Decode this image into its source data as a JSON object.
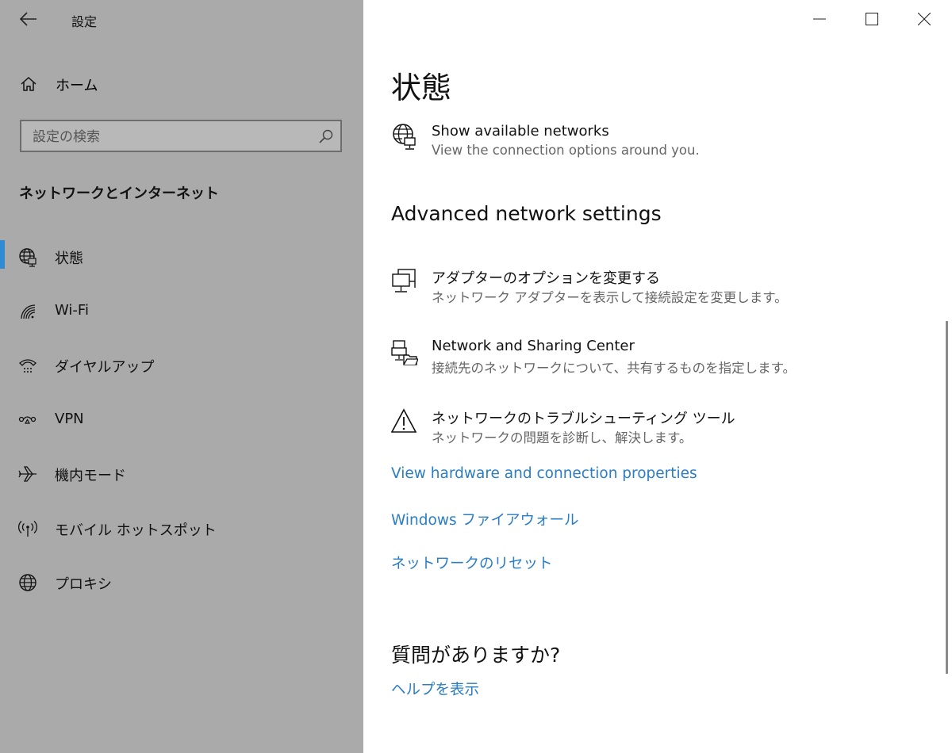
{
  "window": {
    "title": "設定"
  },
  "sidebar": {
    "home_label": "ホーム",
    "search": {
      "placeholder": "設定の検索"
    },
    "section_title": "ネットワークとインターネット",
    "items": [
      {
        "label": "状態",
        "icon": "status-globe-icon",
        "active": true
      },
      {
        "label": "Wi-Fi",
        "icon": "wifi-icon",
        "active": false
      },
      {
        "label": "ダイヤルアップ",
        "icon": "dialup-icon",
        "active": false
      },
      {
        "label": "VPN",
        "icon": "vpn-icon",
        "active": false
      },
      {
        "label": "機内モード",
        "icon": "airplane-icon",
        "active": false
      },
      {
        "label": "モバイル ホットスポット",
        "icon": "hotspot-icon",
        "active": false
      },
      {
        "label": "プロキシ",
        "icon": "globe-icon",
        "active": false
      }
    ]
  },
  "main": {
    "title": "状態",
    "available_networks": {
      "title": "Show available networks",
      "subtitle": "View the connection options around you."
    },
    "advanced_heading": "Advanced network settings",
    "advanced_items": [
      {
        "title": "アダプターのオプションを変更する",
        "subtitle": "ネットワーク アダプターを表示して接続設定を変更します。",
        "icon": "adapter-icon"
      },
      {
        "title": "Network and Sharing Center",
        "subtitle": "接続先のネットワークについて、共有するものを指定します。",
        "icon": "sharing-center-icon"
      },
      {
        "title": "ネットワークのトラブルシューティング ツール",
        "subtitle": "ネットワークの問題を診断し、解決します。",
        "icon": "warning-icon"
      }
    ],
    "links": [
      "View hardware and connection properties",
      "Windows ファイアウォール",
      "ネットワークのリセット"
    ],
    "help_heading": "質問がありますか?",
    "help_link": "ヘルプを表示"
  },
  "colors": {
    "sidebar_bg": "#aaaaaa",
    "accent": "#2e8bd4",
    "link": "#2a7dc4"
  }
}
